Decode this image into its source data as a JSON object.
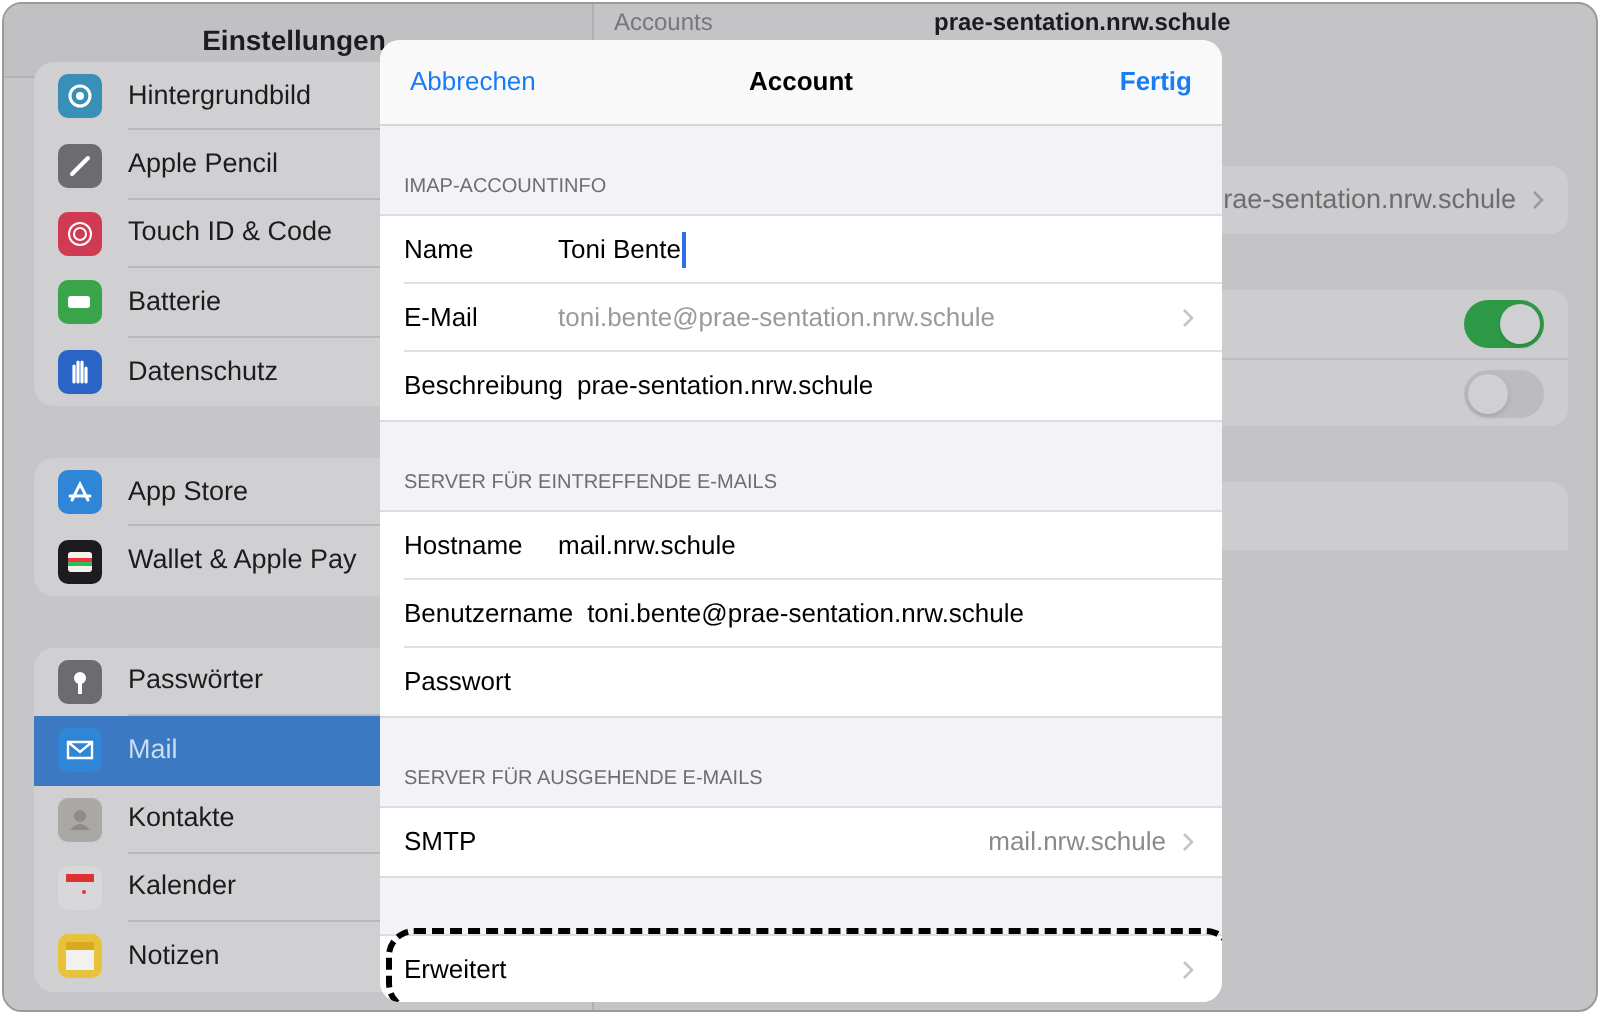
{
  "sidebar": {
    "title": "Einstellungen",
    "groups": [
      [
        {
          "label": "Hintergrundbild",
          "color": "#3a8fb7",
          "selected": false
        },
        {
          "label": "Apple Pencil",
          "color": "#6b6b70",
          "selected": false
        },
        {
          "label": "Touch ID & Code",
          "color": "#d03a52",
          "selected": false
        },
        {
          "label": "Batterie",
          "color": "#3aa44a",
          "selected": false
        },
        {
          "label": "Datenschutz",
          "color": "#2a64c4",
          "selected": false
        }
      ],
      [
        {
          "label": "App Store",
          "color": "#2f86d6",
          "selected": false
        },
        {
          "label": "Wallet & Apple Pay",
          "color": "#1c1c1e",
          "selected": false
        }
      ],
      [
        {
          "label": "Passwörter",
          "color": "#6b6b70",
          "selected": false
        },
        {
          "label": "Mail",
          "color": "#2f86d6",
          "selected": true
        },
        {
          "label": "Kontakte",
          "color": "#a9a8a4",
          "selected": false
        },
        {
          "label": "Kalender",
          "color": "#d8d8da",
          "selected": false
        },
        {
          "label": "Notizen",
          "color": "#e8c23a",
          "selected": false
        }
      ]
    ]
  },
  "detail": {
    "back": "Accounts",
    "title": "prae-sentation.nrw.schule",
    "rows": [
      {
        "kind": "link",
        "value": "rae-sentation.nrw.schule"
      },
      {
        "kind": "toggle",
        "on": true
      },
      {
        "kind": "toggle",
        "on": false
      }
    ]
  },
  "sheet": {
    "cancel": "Abbrechen",
    "title": "Account",
    "done": "Fertig",
    "sections": [
      {
        "header": "IMAP-ACCOUNTINFO",
        "rows": [
          {
            "kind": "field",
            "label": "Name",
            "value": "Toni Bente",
            "focused": true,
            "highlighted": false
          },
          {
            "kind": "readonly",
            "label": "E-Mail",
            "value": "toni.bente@prae-sentation.nrw.schule",
            "highlighted": false
          },
          {
            "kind": "field",
            "label": "Beschreibung",
            "value": "prae-sentation.nrw.schule",
            "focused": false,
            "highlighted": false
          }
        ]
      },
      {
        "header": "SERVER FÜR EINTREFFENDE E-MAILS",
        "rows": [
          {
            "kind": "field",
            "label": "Hostname",
            "value": "mail.nrw.schule",
            "focused": false,
            "highlighted": false
          },
          {
            "kind": "field",
            "label": "Benutzername",
            "value": "toni.bente@prae-sentation.nrw.schule",
            "focused": false,
            "highlighted": false
          },
          {
            "kind": "field",
            "label": "Passwort",
            "focused": false,
            "highlighted": false
          }
        ]
      },
      {
        "header": "SERVER FÜR AUSGEHENDE E-MAILS",
        "rows": [
          {
            "kind": "link",
            "label": "SMTP",
            "value": "mail.nrw.schule",
            "highlighted": false
          }
        ]
      },
      {
        "rows": [
          {
            "kind": "link",
            "label": "Erweitert",
            "highlighted": true
          }
        ]
      }
    ]
  }
}
